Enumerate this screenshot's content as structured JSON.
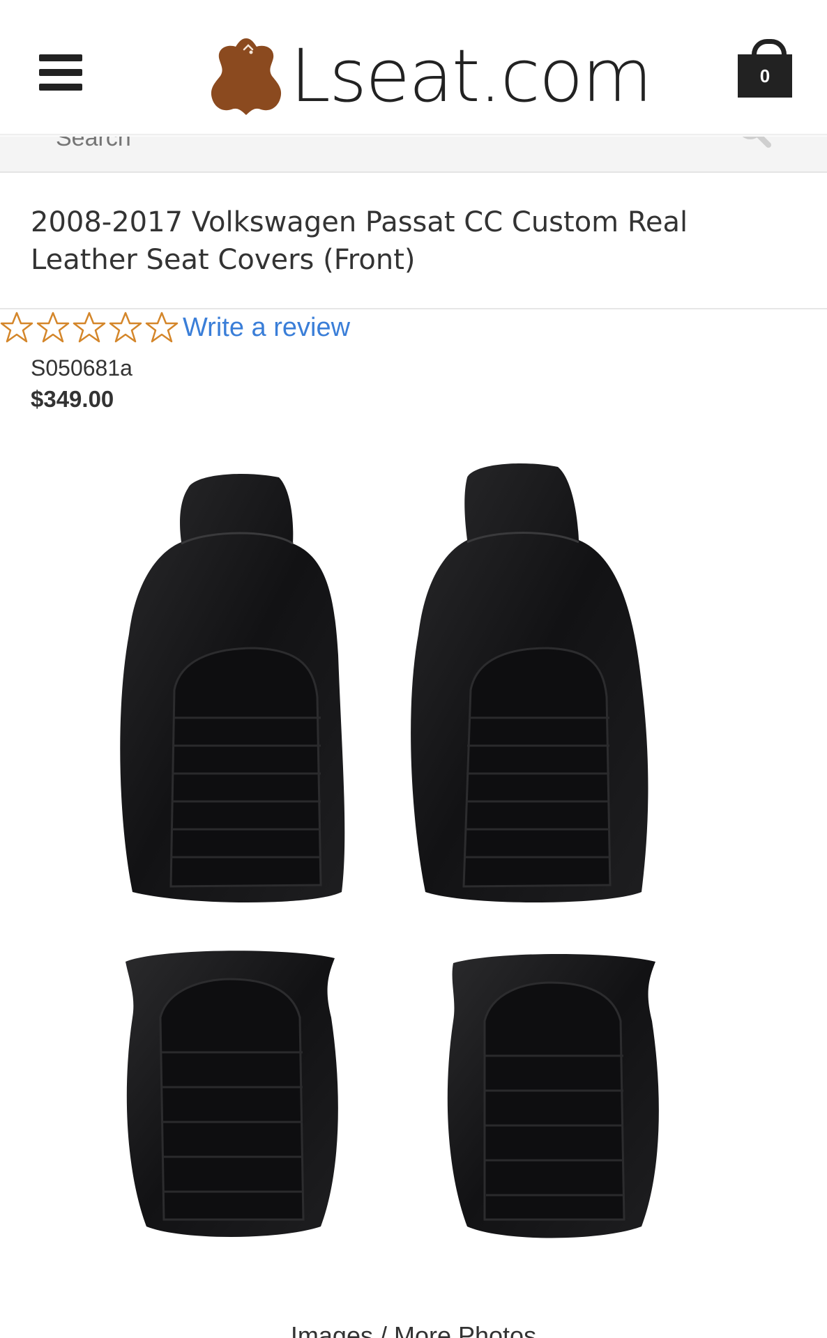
{
  "header": {
    "logo_text": "Lseat.com",
    "cart_count": "0",
    "icons": {
      "menu": "hamburger-menu-icon",
      "cart": "shopping-bag-icon",
      "logo": "leather-hide-icon"
    }
  },
  "search": {
    "placeholder": "Search",
    "icon": "search-icon"
  },
  "product": {
    "title": "2008-2017 Volkswagen Passat CC Custom Real Leather Seat Covers (Front)",
    "rating": {
      "stars_filled": 0,
      "stars_total": 5,
      "review_link": "Write a review"
    },
    "sku": "S050681a",
    "price": "$349.00",
    "image_alt": "Black leather front seat covers"
  },
  "gallery": {
    "label": "Images / More Photos"
  },
  "colors": {
    "star_outline": "#d4862a",
    "link": "#3a7ed8",
    "logo_brown": "#8b4a1f",
    "text": "#333333"
  }
}
